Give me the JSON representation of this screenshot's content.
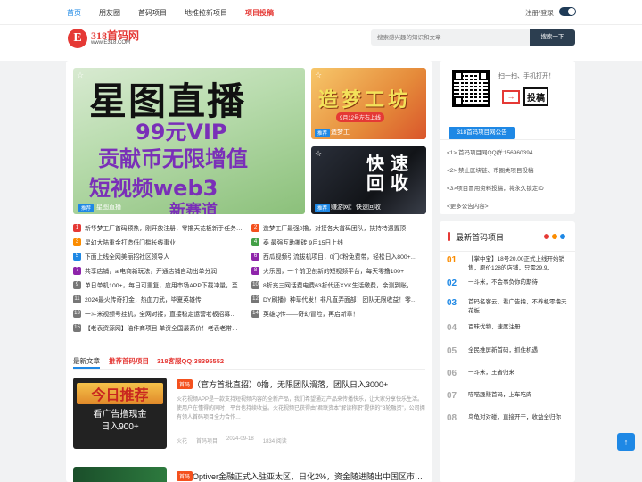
{
  "nav": {
    "items": [
      "首页",
      "朋友圈",
      "首码项目",
      "地推拉新项目",
      "项目投稿"
    ],
    "login": "注册/登录"
  },
  "header": {
    "logo_letter": "E",
    "logo_title": "318首码网",
    "logo_sub": "www.E318.COM",
    "search_placeholder": "搜索感兴趣的知识和文章",
    "search_button": "搜索一下"
  },
  "slider": {
    "big": {
      "lines": [
        "星图直播",
        "99元VIP",
        "贡献币无限增值",
        "短视频web3",
        "新赛道"
      ],
      "tag": "推荐",
      "caption": "星图直播"
    },
    "top_right": {
      "lines": [
        "造梦工坊",
        "9月12号左右上线"
      ],
      "tag": "推荐",
      "caption": "造梦工"
    },
    "bottom_right": {
      "lines": [
        "快 速",
        "回 收"
      ],
      "tag": "推荐",
      "caption": "赚游网：快速回收"
    }
  },
  "news": [
    {
      "num": "1",
      "color": "#e53935",
      "text": "新华梦工厂首码预热，刚开放注册，零撸天花板新手任务…"
    },
    {
      "num": "2",
      "color": "#f4511e",
      "text": "造梦工厂最强0撸，对接各大首码团队，扶持待遇置顶"
    },
    {
      "num": "3",
      "color": "#fb8c00",
      "text": "星幻大陆重金打造低门槛长线事业"
    },
    {
      "num": "4",
      "color": "#43a047",
      "text": "泰 最强互助搬砖 9月15日上线"
    },
    {
      "num": "5",
      "color": "#1e88e5",
      "text": "下面上线全网美丽招社区领导人"
    },
    {
      "num": "6",
      "color": "#8e24aa",
      "text": "西瓜视频引流拔机项目，0门0粉免费带，轻松日入800+…"
    },
    {
      "num": "7",
      "color": "#8e24aa",
      "text": "共享店铺，ai电商新玩法，开通店铺自动出单分润"
    },
    {
      "num": "8",
      "color": "#8e24aa",
      "text": "火乐园，一个前卫创新的短视频平台，每天零撸100+"
    },
    {
      "num": "9",
      "color": "#777",
      "text": "单日单机100+，每日可重复，应用市场APP下载冲量，至…"
    },
    {
      "num": "10",
      "color": "#777",
      "text": "8折充三网话费电费63折代还XYK生活缴费，余测到账，…"
    },
    {
      "num": "11",
      "color": "#777",
      "text": "2024最火传奇打金，热血刀武，毕夏英雄传"
    },
    {
      "num": "12",
      "color": "#777",
      "text": "DY刷播》种草代发！非凡直弄面部！团队无限收益！零…"
    },
    {
      "num": "13",
      "color": "#777",
      "text": "一斗米视频号挂机，全网对接，直接稳定运营老板招募…"
    },
    {
      "num": "14",
      "color": "#777",
      "text": "英雄Q传——奇幻冒险，再启新章！"
    },
    {
      "num": "15",
      "color": "#777",
      "text": "【老表资源网】油件商项目 单资全国最高价！老表老带…"
    }
  ],
  "tabs": {
    "latest": "最新文章",
    "recommend": "推荐首码项目",
    "qq": "318客服QQ:38395552"
  },
  "article": {
    "thumb_title": "今日推荐",
    "thumb_line1": "看广告撸现金",
    "thumb_line2": "日入900+",
    "tag": "首码",
    "title": "（官方首批直招）0撸，无限团队滑落，团队日入3000+",
    "desc": "火花视频APP是一款支持短视频内容的全新产品，我们希望通过产品来传播快乐，让大家分享快乐生活。使用户在懂得的同时，平台也持续收益。火花视频已获得由\"君联资本\"解读称职\"提供的\"B轮融资\"，公司拥有领人首码项目全力合作…",
    "author": "火花",
    "category": "首码项目",
    "date": "2024-09-18",
    "views": "1834 阅读"
  },
  "article2": {
    "tag": "首码",
    "title": "Optiver金融正式入驻亚太区，日化2%，资金随进随出中国区市…"
  },
  "side": {
    "scan_text": "扫一扫、手机打开！",
    "tougao_icon": "→",
    "tougao_label": "投稿",
    "notice_tab": "318首码项目网公告",
    "notices": [
      "<1> 首码项目网QQ群:156960394",
      "<2> 禁止区块链、币圈类项目投稿",
      "<3>项目冒用资料投稿，将永久锁定ID",
      "<更多公告内容>"
    ]
  },
  "ranking": {
    "title": "最新首码项目",
    "items": [
      {
        "num": "01",
        "color": "#fb8c00",
        "text": "【掌中宝】18号20.00正式上线开始销售，原价128的店铺，只需29.9，"
      },
      {
        "num": "02",
        "color": "#1e88e5",
        "text": "一斗米，不会事负你的期待"
      },
      {
        "num": "03",
        "color": "#1e88e5",
        "text": "首码名客云，看广告撸，不养机零撸天花板"
      },
      {
        "num": "04",
        "color": "#aaa",
        "text": "百昧优物，速度注册"
      },
      {
        "num": "05",
        "color": "#aaa",
        "text": "全民推屏新首码，抓住机遇"
      },
      {
        "num": "06",
        "color": "#aaa",
        "text": "一斗米，王者归来"
      },
      {
        "num": "07",
        "color": "#aaa",
        "text": "喵喵趣赚首码，上车吃肉"
      },
      {
        "num": "08",
        "color": "#aaa",
        "text": "鸟龟对对碰，直接开干，收益全归你"
      }
    ]
  },
  "backtop": "↑"
}
